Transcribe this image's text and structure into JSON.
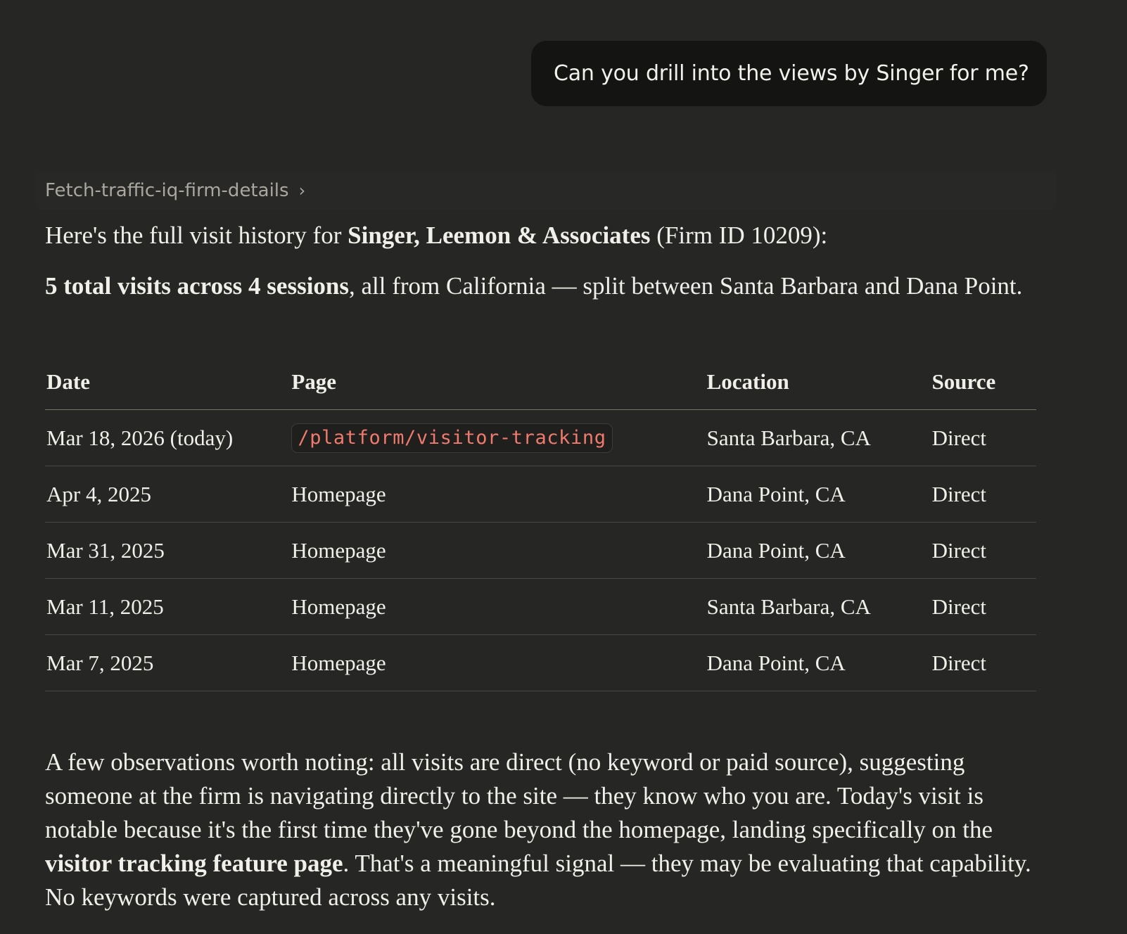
{
  "user_message": "Can you drill into the views by Singer for me?",
  "tool_call": {
    "label": "Fetch-traffic-iq-firm-details",
    "chevron": "›"
  },
  "response": {
    "intro": {
      "prefix": "Here's the full visit history for ",
      "firm_name": "Singer, Leemon & Associates",
      "suffix": " (Firm ID 10209):"
    },
    "summary": {
      "bold": "5 total visits across 4 sessions",
      "rest": ", all from California — split between Santa Barbara and Dana Point."
    },
    "table": {
      "headers": [
        "Date",
        "Page",
        "Location",
        "Source"
      ],
      "rows": [
        {
          "date": "Mar 18, 2026 (today)",
          "page": "/platform/visitor-tracking",
          "page_is_code": true,
          "location": "Santa Barbara, CA",
          "source": "Direct"
        },
        {
          "date": "Apr 4, 2025",
          "page": "Homepage",
          "page_is_code": false,
          "location": "Dana Point, CA",
          "source": "Direct"
        },
        {
          "date": "Mar 31, 2025",
          "page": "Homepage",
          "page_is_code": false,
          "location": "Dana Point, CA",
          "source": "Direct"
        },
        {
          "date": "Mar 11, 2025",
          "page": "Homepage",
          "page_is_code": false,
          "location": "Santa Barbara, CA",
          "source": "Direct"
        },
        {
          "date": "Mar 7, 2025",
          "page": "Homepage",
          "page_is_code": false,
          "location": "Dana Point, CA",
          "source": "Direct"
        }
      ]
    },
    "observations": {
      "part1": "A few observations worth noting: all visits are direct (no keyword or paid source), suggesting someone at the firm is navigating directly to the site — they know who you are. Today's visit is notable because it's the first time they've gone beyond the homepage, landing specifically on the ",
      "bold": "visitor tracking feature page",
      "part2": ". That's a meaningful signal — they may be evaluating that capability. No keywords were captured across any visits."
    }
  },
  "colors": {
    "background": "#262624",
    "user_bubble": "#141413",
    "text": "#f0efea",
    "muted_text": "#a9a79f",
    "code_text": "#f07a6d"
  }
}
